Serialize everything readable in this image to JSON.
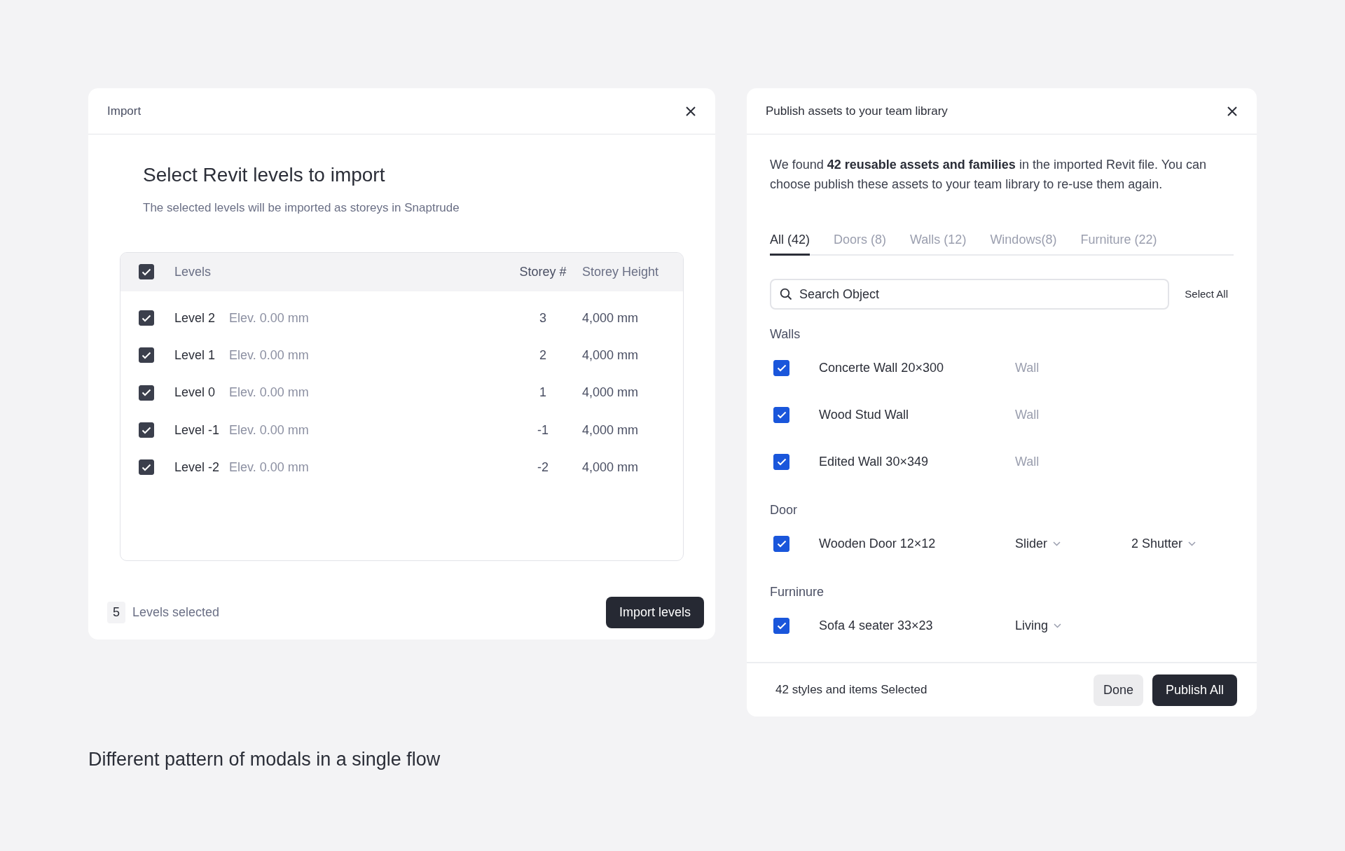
{
  "import_modal": {
    "title": "Import",
    "heading": "Select Revit levels to import",
    "subtitle": "The selected levels will be imported as storeys in Snaptrude",
    "table": {
      "header_checked": true,
      "columns": [
        "Levels",
        "Storey #",
        "Storey Height"
      ],
      "rows": [
        {
          "checked": true,
          "name": "Level 2",
          "elevation": "Elev. 0.00 mm",
          "storey": "3",
          "height": "4,000 mm"
        },
        {
          "checked": true,
          "name": "Level 1",
          "elevation": "Elev. 0.00 mm",
          "storey": "2",
          "height": "4,000 mm"
        },
        {
          "checked": true,
          "name": "Level 0",
          "elevation": "Elev. 0.00 mm",
          "storey": "1",
          "height": "4,000 mm"
        },
        {
          "checked": true,
          "name": "Level -1",
          "elevation": "Elev. 0.00 mm",
          "storey": "-1",
          "height": "4,000 mm"
        },
        {
          "checked": true,
          "name": "Level -2",
          "elevation": "Elev. 0.00 mm",
          "storey": "-2",
          "height": "4,000 mm"
        }
      ]
    },
    "footer": {
      "count": "5",
      "label": "Levels selected",
      "button": "Import levels"
    }
  },
  "publish_modal": {
    "title": "Publish assets to your team library",
    "description": "We found **42 reusable assets and families** in the imported Revit file. You can choose publish these assets to your team library to re-use them again.",
    "tabs": [
      {
        "label": "All (42)",
        "selected": true
      },
      {
        "label": "Doors (8)",
        "selected": false
      },
      {
        "label": "Walls (12)",
        "selected": false
      },
      {
        "label": "Windows(8)",
        "selected": false
      },
      {
        "label": "Furniture (22)",
        "selected": false
      }
    ],
    "search": {
      "placeholder": "Search Object"
    },
    "select_all": "Select All",
    "groups": [
      {
        "label": "Walls",
        "items": [
          {
            "checked": true,
            "name": "Concerte Wall 20×300",
            "fields": [
              {
                "kind": "text",
                "value": "Wall"
              }
            ]
          },
          {
            "checked": true,
            "name": "Wood Stud Wall",
            "fields": [
              {
                "kind": "text",
                "value": "Wall"
              }
            ]
          },
          {
            "checked": true,
            "name": "Edited Wall 30×349",
            "fields": [
              {
                "kind": "text",
                "value": "Wall"
              }
            ]
          }
        ]
      },
      {
        "label": "Door",
        "items": [
          {
            "checked": true,
            "name": "Wooden Door 12×12",
            "fields": [
              {
                "kind": "dropdown",
                "value": "Slider"
              },
              {
                "kind": "dropdown",
                "value": "2 Shutter"
              }
            ]
          }
        ]
      },
      {
        "label": "Furninure",
        "items": [
          {
            "checked": true,
            "name": "Sofa 4 seater 33×23",
            "fields": [
              {
                "kind": "dropdown",
                "value": "Living"
              }
            ]
          }
        ]
      }
    ],
    "footer": {
      "summary": "42 styles and items Selected",
      "buttons": [
        {
          "label": "Done",
          "kind": "secondary"
        },
        {
          "label": "Publish All",
          "kind": "primary"
        }
      ]
    }
  },
  "caption": "Different pattern of modals in a single flow"
}
